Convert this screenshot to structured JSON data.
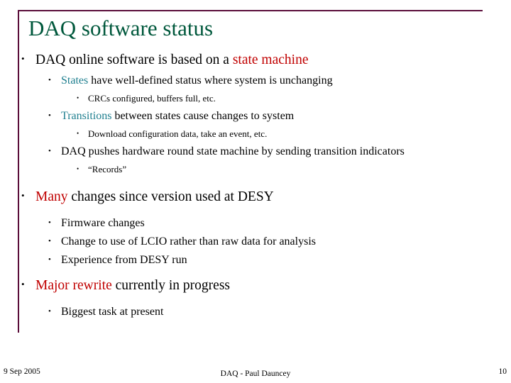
{
  "slide": {
    "title": "DAQ software status",
    "bullets": {
      "b1": "DAQ online software is based on a ",
      "b1_hl": "state machine",
      "b2_hl": "States",
      "b2": " have well-defined status where system is unchanging",
      "b3": "CRCs configured, buffers full, etc.",
      "b4_hl": "Transitions",
      "b4": " between states cause changes to system",
      "b5": "Download configuration data, take an event, etc.",
      "b6": "DAQ pushes hardware round state machine by sending transition indicators",
      "b7": "“Records”",
      "b8_hl": "Many",
      "b8": " changes since version used at DESY",
      "b9": "Firmware changes",
      "b10": "Change to use of LCIO rather than raw data for analysis",
      "b11": "Experience from DESY run",
      "b12_hl": "Major rewrite",
      "b12": " currently in progress",
      "b13": "Biggest task at present"
    },
    "footer": {
      "date": "9 Sep 2005",
      "center": "DAQ - Paul Dauncey",
      "page": "10"
    },
    "colors": {
      "title": "#00583c",
      "rule": "#5a0d3a",
      "red": "#c00000",
      "teal": "#1f7f8f",
      "blue": "#2e5fa3"
    }
  }
}
